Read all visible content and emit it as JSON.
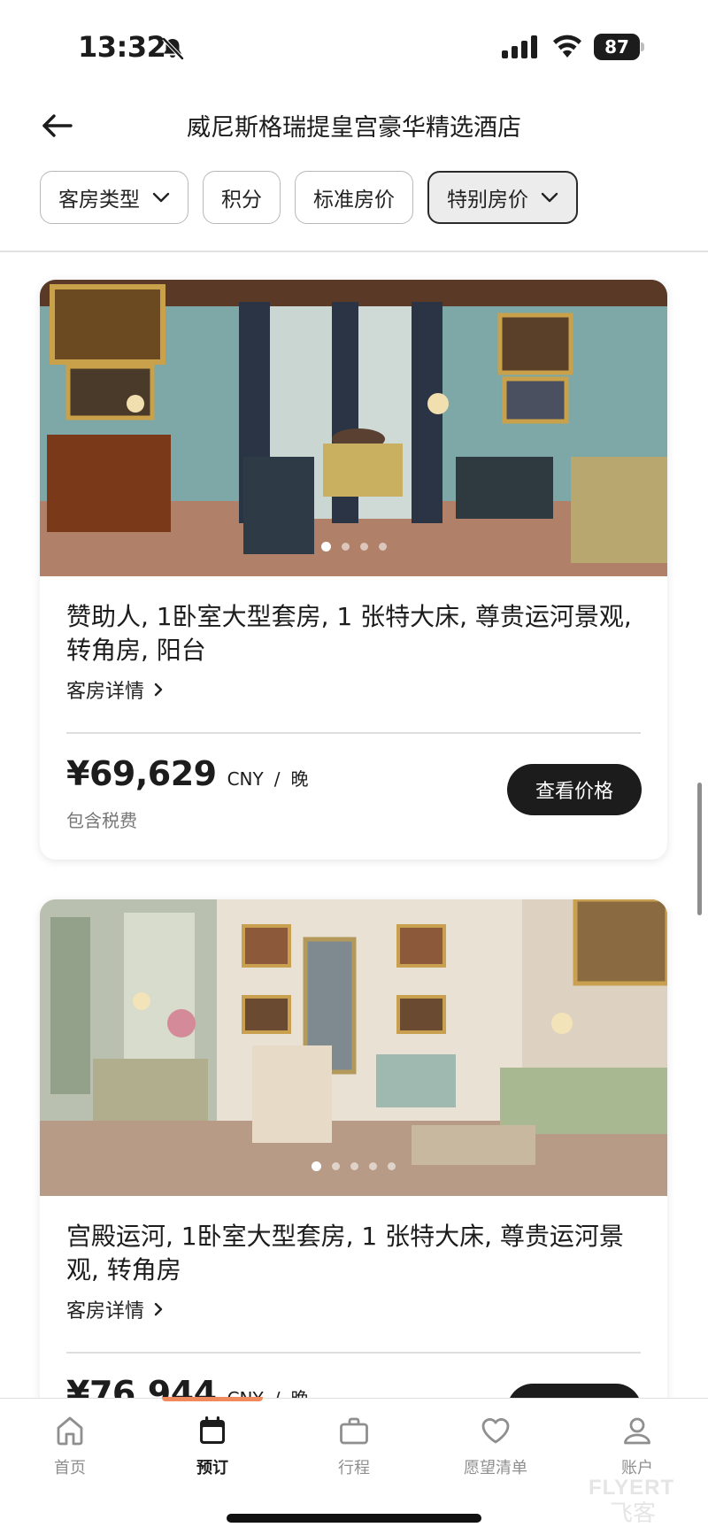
{
  "status_bar": {
    "time": "13:32",
    "battery": "87"
  },
  "header": {
    "title": "威尼斯格瑞提皇宫豪华精选酒店"
  },
  "filters": [
    {
      "label": "客房类型",
      "has_dropdown": true,
      "active": false
    },
    {
      "label": "积分",
      "has_dropdown": false,
      "active": false
    },
    {
      "label": "标准房价",
      "has_dropdown": false,
      "active": false
    },
    {
      "label": "特别房价",
      "has_dropdown": true,
      "active": true
    }
  ],
  "rooms": [
    {
      "name": "赞助人, 1卧室大型套房, 1 张特大床, 尊贵运河景观, 转角房, 阳台",
      "details_label": "客房详情",
      "price": "¥69,629",
      "currency": "CNY",
      "separator": "/",
      "per_unit": "晚",
      "tax_note": "包含税费",
      "button_label": "查看价格",
      "carousel_pages": 4,
      "carousel_active": 1
    },
    {
      "name": "宫殿运河, 1卧室大型套房, 1 张特大床, 尊贵运河景观, 转角房",
      "details_label": "客房详情",
      "price": "¥76,944",
      "currency": "CNY",
      "separator": "/",
      "per_unit": "晚",
      "tax_note": "",
      "button_label": "",
      "carousel_pages": 5,
      "carousel_active": 1
    }
  ],
  "tab_bar": {
    "active": "预订",
    "tabs": [
      {
        "label": "首页",
        "icon": "home-icon"
      },
      {
        "label": "预订",
        "icon": "calendar-icon"
      },
      {
        "label": "行程",
        "icon": "briefcase-icon"
      },
      {
        "label": "愿望清单",
        "icon": "heart-icon"
      },
      {
        "label": "账户",
        "icon": "person-icon"
      }
    ]
  },
  "watermark": "FLYERT 飞客",
  "colors": {
    "accent": "#f08a5d",
    "primary_button": "#1c1c1c"
  }
}
